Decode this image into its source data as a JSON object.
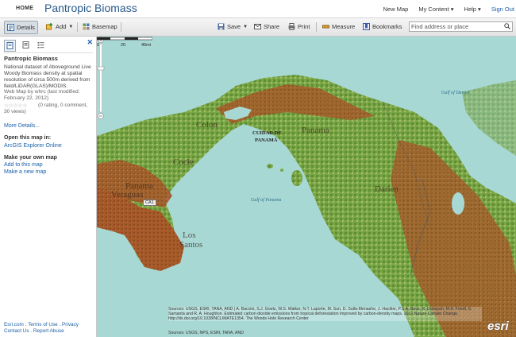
{
  "header": {
    "home": "HOME",
    "title": "Pantropic Biomass",
    "nav": [
      "New Map",
      "My Content ▾",
      "Help ▾"
    ],
    "signout": "Sign Out"
  },
  "toolbar": {
    "details": "Details",
    "add": "Add",
    "basemap": "Basemap",
    "save": "Save",
    "share": "Share",
    "print": "Print",
    "measure": "Measure",
    "bookmarks": "Bookmarks",
    "search_placeholder": "Find address or place"
  },
  "sidebar": {
    "title": "Pantropic Biomass",
    "description": "National dataset of Aboveground Live Woody Biomass density at spatial resolution of circa 500m derived from field/LiDAR(GLAS)/MODIS.",
    "webmap": "Web Map by whrc (last modified: February 22, 2012)",
    "stars": "☆☆☆☆☆",
    "rating": "(0 rating, 0 comment, 30 views)",
    "more_details": "More Details...",
    "open_heading": "Open this map in:",
    "open_link": "ArcGIS Explorer Online",
    "make_heading": "Make your own map",
    "add_link": "Add to this map",
    "new_link": "Make a new map",
    "footer": "Esri.com . Terms of Use . Privacy\nContact Us . Report Abuse"
  },
  "map": {
    "labels": {
      "gulf_darien": "Gulf of Darien",
      "colon": "Colon",
      "panama_prov": "Panama",
      "cuidad": "CUIDAD DE",
      "cuidad2": "PANAMÁ",
      "cocle": "Cocle",
      "panama_west": "Panama",
      "veraguas": "Veraguas",
      "darien": "Darien",
      "gulf_panama": "Gulf of Panama",
      "los": "Los",
      "santos": "Santos",
      "road": "CA1"
    },
    "scale": {
      "l0": "0",
      "l1": "20",
      "l2": "40mi"
    },
    "attribution": "Sources: USGS, ESRI, TANA, AND | A. Baccini, S.J. Goetz, W.S. Walker, N.T. Laporte, M. Sun, D. Sulla-Menashe, J. Hackler, P.S.A. Beck, R. Dubayah, M.A. Friedl, S. Samanta and R. A. Houghton. Estimated carbon dioxide emissions from tropical deforestation improved by carbon-density maps. 2012 Nature Climate Change, http://dx.doi.org/10.1038/NCLIMATE1354. The Woods Hole Research Center",
    "attribution2": "Sources: USGS, NPS, ESRI, TANA, AND",
    "logo": "esri"
  }
}
